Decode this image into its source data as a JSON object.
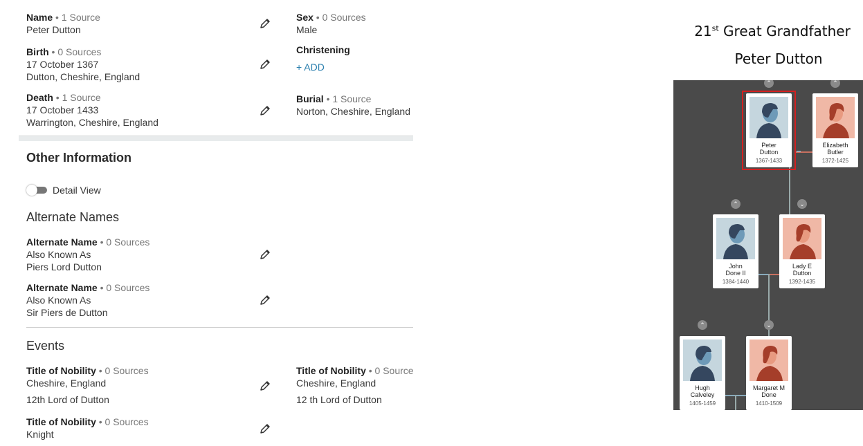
{
  "facts": {
    "name": {
      "label": "Name",
      "sources": " • 1 Source",
      "value": "Peter Dutton"
    },
    "sex": {
      "label": "Sex",
      "sources": " • 0 Sources",
      "value": "Male"
    },
    "birth": {
      "label": "Birth",
      "sources": " • 0 Sources",
      "date": "17 October 1367",
      "place": "Dutton, Cheshire, England"
    },
    "christening": {
      "label": "Christening",
      "add": "+ ADD"
    },
    "death": {
      "label": "Death",
      "sources": " • 1 Source",
      "date": "17 October 1433",
      "place": "Warrington, Cheshire, England"
    },
    "burial": {
      "label": "Burial",
      "sources": " • 1 Source",
      "place": "Norton, Cheshire, England"
    }
  },
  "other": {
    "heading": "Other Information",
    "toggle_label": "Detail View",
    "alt_heading": "Alternate Names",
    "alt_names": [
      {
        "label": "Alternate Name",
        "sources": " • 0 Sources",
        "type": "Also Known As",
        "value": "Piers Lord Dutton"
      },
      {
        "label": "Alternate Name",
        "sources": " • 0 Sources",
        "type": "Also Known As",
        "value": "Sir Piers de Dutton"
      }
    ],
    "events_heading": "Events",
    "events": [
      {
        "label": "Title of Nobility",
        "sources": " • 0 Sources",
        "place": "Cheshire, England",
        "desc": "12th Lord of Dutton"
      },
      {
        "label": "Title of Nobility",
        "sources": " • 0 Source",
        "place": "Cheshire, England",
        "desc": "12 th Lord of Dutton"
      },
      {
        "label": "Title of Nobility",
        "sources": " • 0 Sources",
        "place": "Knight"
      }
    ]
  },
  "caption": {
    "gen": "21",
    "sup": "st",
    "relation": " Great Grandfather",
    "person": "Peter Dutton"
  },
  "tree": {
    "people": [
      {
        "name1": "Peter",
        "name2": "Dutton",
        "years": "1367-1433",
        "sex": "male"
      },
      {
        "name1": "Elizabeth",
        "name2": "Butler",
        "years": "1372-1425",
        "sex": "female"
      },
      {
        "name1": "John",
        "name2": "Done II",
        "years": "1384-1440",
        "sex": "male"
      },
      {
        "name1": "Lady E",
        "name2": "Dutton",
        "years": "1392-1435",
        "sex": "female"
      },
      {
        "name1": "Hugh",
        "name2": "Calveley",
        "years": "1405-1459",
        "sex": "male"
      },
      {
        "name1": "Margaret M",
        "name2": "Done",
        "years": "1410-1509",
        "sex": "female"
      }
    ],
    "colors": {
      "bg": "#4a4a4a",
      "male_bg": "#c5d6de",
      "female_bg": "#f0b8a6",
      "selected": "#d42020"
    }
  }
}
